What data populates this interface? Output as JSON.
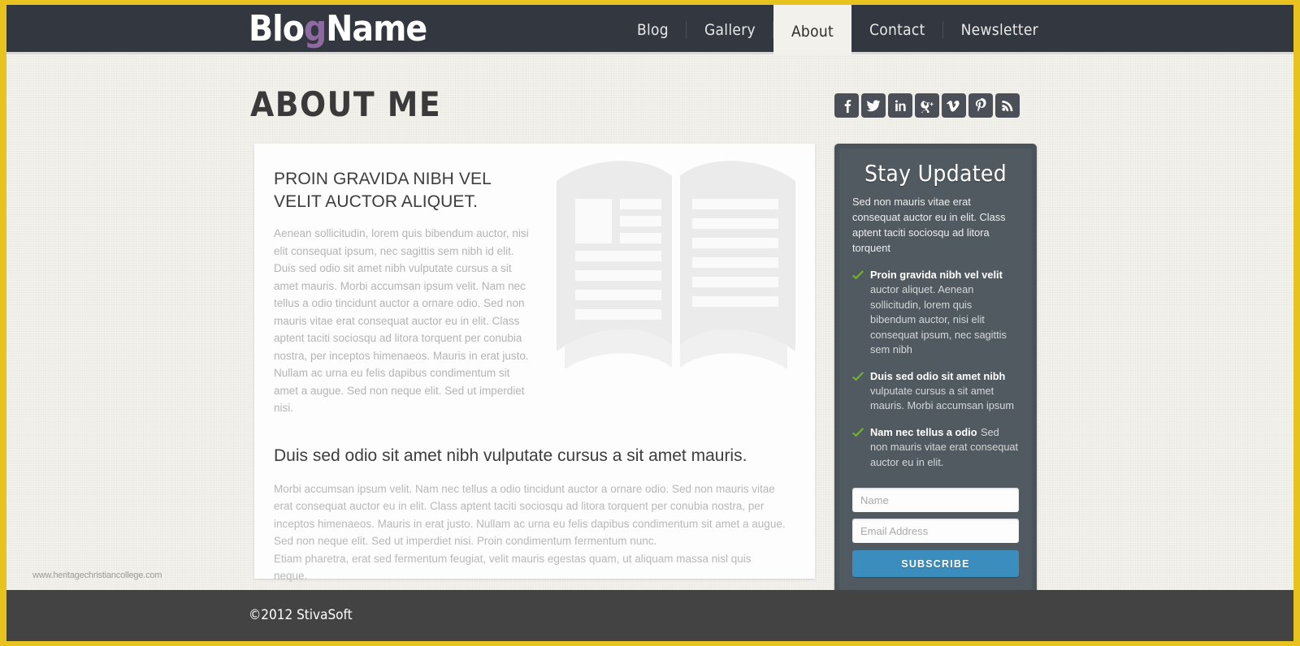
{
  "brand": {
    "name_part1": "Blo",
    "name_accent": "g",
    "name_part2": "Name",
    "accent_color": "#8d6a9f"
  },
  "theme": {
    "frame_color": "#e8c31f",
    "header_bg": "#333740",
    "page_bg": "#f2f1ec",
    "widget_bg": "#515a60",
    "subscribe_color": "#3b8dbd",
    "check_color": "#6fb42f",
    "footer_bg": "#434343"
  },
  "nav": {
    "items": [
      {
        "label": "Blog",
        "active": false
      },
      {
        "label": "Gallery",
        "active": false
      },
      {
        "label": "About",
        "active": true
      },
      {
        "label": "Contact",
        "active": false
      },
      {
        "label": "Newsletter",
        "active": false
      }
    ]
  },
  "page": {
    "title": "About Me"
  },
  "social": {
    "items": [
      {
        "name": "facebook-icon",
        "label": "Facebook"
      },
      {
        "name": "twitter-icon",
        "label": "Twitter"
      },
      {
        "name": "linkedin-icon",
        "label": "LinkedIn"
      },
      {
        "name": "google-plus-icon",
        "label": "Google+"
      },
      {
        "name": "vimeo-icon",
        "label": "Vimeo"
      },
      {
        "name": "pinterest-icon",
        "label": "Pinterest"
      },
      {
        "name": "rss-icon",
        "label": "RSS"
      }
    ]
  },
  "article": {
    "heading1": "Proin gravida nibh vel velit auctor aliquet.",
    "paragraph1": "Aenean sollicitudin, lorem quis bibendum auctor, nisi elit consequat ipsum, nec sagittis sem nibh id elit. Duis sed odio sit amet nibh vulputate cursus a sit amet mauris. Morbi accumsan ipsum velit. Nam nec tellus a odio tincidunt auctor a ornare odio. Sed non  mauris vitae erat consequat auctor eu in elit. Class aptent taciti sociosqu ad litora torquent per conubia nostra, per inceptos himenaeos. Mauris in erat justo. Nullam ac urna eu felis dapibus condimentum sit amet a augue. Sed non neque elit. Sed ut imperdiet nisi.",
    "heading2": "Duis sed odio sit amet nibh vulputate cursus a sit amet mauris.",
    "paragraph2": "Morbi accumsan ipsum velit. Nam nec tellus a odio tincidunt auctor a ornare odio. Sed non  mauris vitae erat consequat auctor eu in elit. Class aptent taciti sociosqu ad litora torquent per conubia nostra, per inceptos himenaeos. Mauris in erat justo. Nullam ac urna eu felis dapibus condimentum sit amet a augue. Sed non neque elit. Sed ut imperdiet nisi. Proin condimentum fermentum nunc.",
    "paragraph3": "Etiam pharetra, erat sed fermentum feugiat, velit mauris egestas quam, ut aliquam massa nisl quis neque.",
    "illustration": "open-book-illustration"
  },
  "widget": {
    "title": "Stay Updated",
    "intro": "Sed non  mauris vitae erat consequat auctor eu in elit. Class aptent taciti sociosqu ad litora torquent",
    "features": [
      {
        "title": "Proin gravida nibh vel velit",
        "text": "auctor aliquet. Aenean sollicitudin, lorem quis bibendum auctor, nisi elit consequat ipsum, nec sagittis sem nibh"
      },
      {
        "title": "Duis sed odio sit amet nibh",
        "text": "vulputate cursus a sit amet mauris. Morbi accumsan ipsum"
      },
      {
        "title": "Nam nec tellus a odio",
        "text": "Sed non  mauris vitae erat consequat auctor eu in elit."
      }
    ],
    "form": {
      "name_placeholder": "Name",
      "name_value": "",
      "email_placeholder": "Email Address",
      "email_value": "",
      "submit_label": "SUBSCRIBE"
    }
  },
  "footer": {
    "copyright": "©2012 StivaSoft"
  },
  "watermark": {
    "text": "www.heritagechristiancollege.com"
  }
}
